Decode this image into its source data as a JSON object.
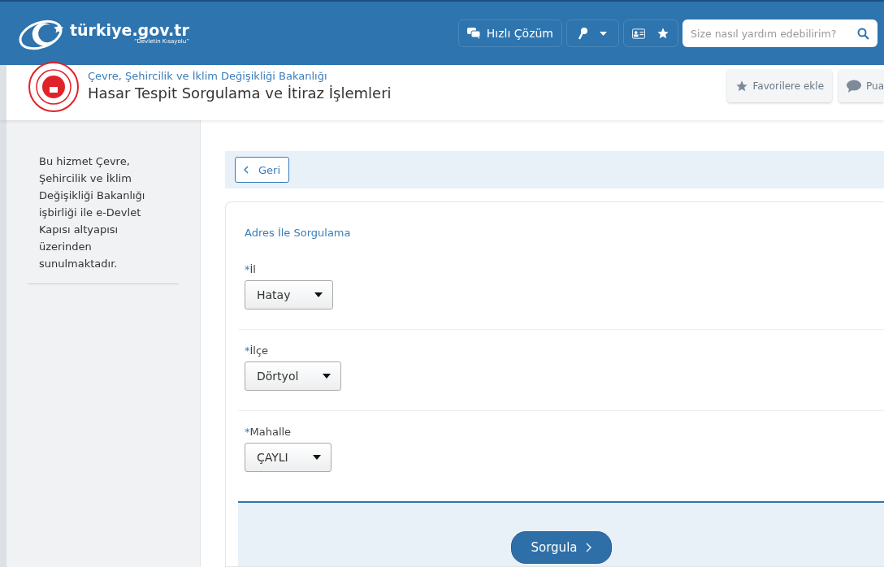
{
  "header": {
    "logo_text": "türkiye.gov.tr",
    "logo_tagline": "“Devletin Kısayolu”",
    "quick_solution": "Hızlı Çözüm",
    "search": {
      "placeholder": "Size nasıl yardım edebilirim?"
    }
  },
  "service": {
    "ministry": "Çevre, Şehircilik ve İklim Değişikliği Bakanlığı",
    "title": "Hasar Tespit Sorgulama ve İtiraz İşlemleri",
    "actions": [
      "Favorilere ekle",
      "Pua"
    ]
  },
  "sidebar": {
    "info": "Bu hizmet Çevre, Şehircilik ve İklim Değişikliği Bakanlığı işbirliği ile e-Devlet Kapısı altyapısı üzerinden sunulmaktadır."
  },
  "back_button": "Geri",
  "form": {
    "heading": "Adres İle Sorgulama",
    "fields": [
      {
        "required_mark": "*",
        "label": "İl",
        "value": "Hatay"
      },
      {
        "required_mark": "*",
        "label": "İlçe",
        "value": "Dörtyol"
      },
      {
        "required_mark": "*",
        "label": "Mahalle",
        "value": "ÇAYLI"
      }
    ],
    "submit": "Sorgula"
  }
}
